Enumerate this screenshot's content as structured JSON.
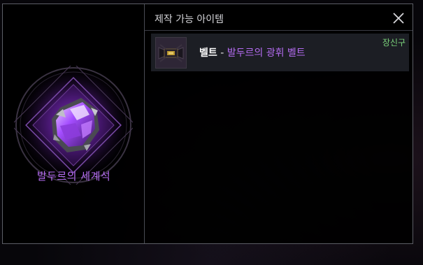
{
  "material": {
    "name": "발두르의 세계석"
  },
  "craftable_panel": {
    "title": "제작 가능 아이템",
    "items": [
      {
        "type": "벨트",
        "separator": " - ",
        "name": "발두르의 광휘 벨트",
        "grade": "장신구"
      }
    ]
  },
  "colors": {
    "name_purple": "#b56cf2",
    "grade_green": "#7cd47c",
    "row_bg": "#1c1e24"
  },
  "icons": {
    "material": "purple-crystal-icon",
    "item": "belt-icon",
    "close": "close-icon"
  }
}
